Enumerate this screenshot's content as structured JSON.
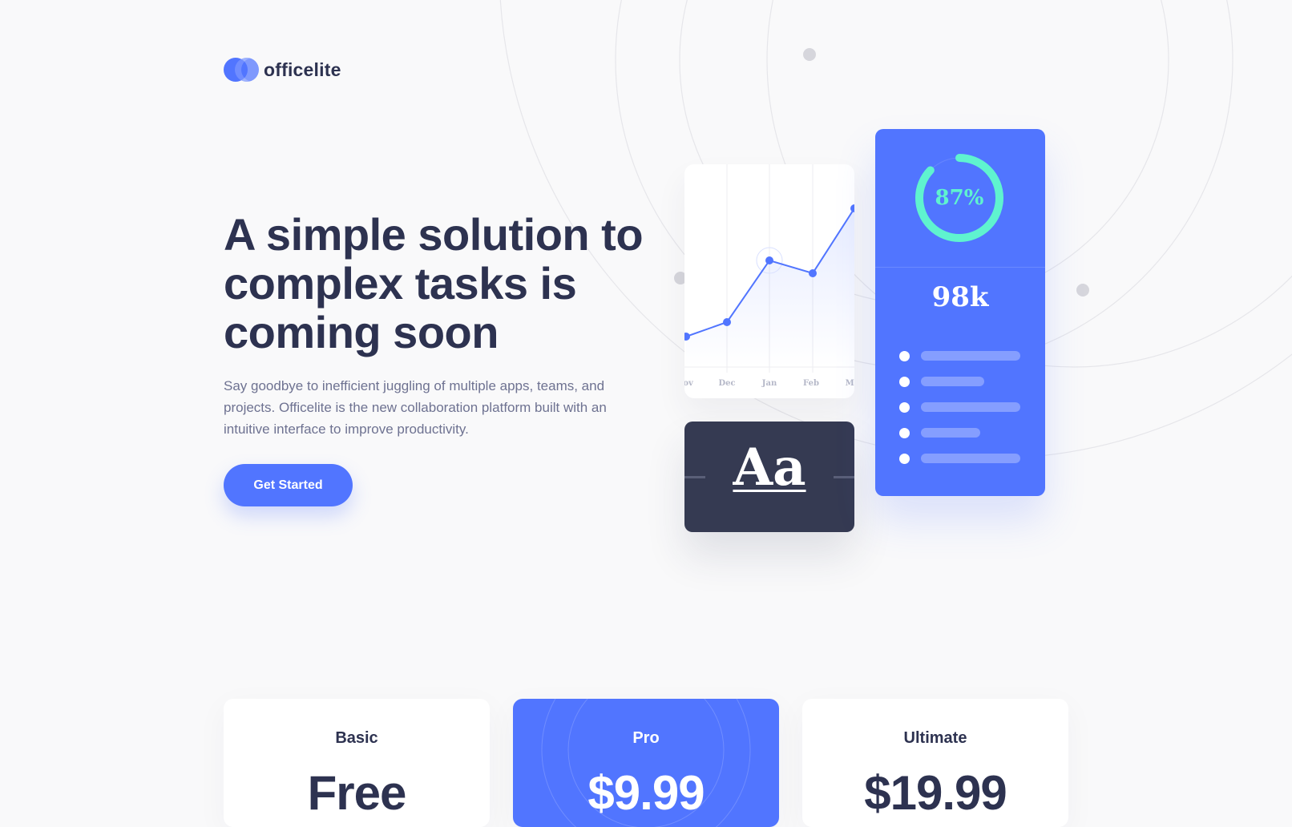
{
  "brand": {
    "name": "officelite",
    "logo_icon": "logo-icon"
  },
  "hero": {
    "title": "A simple solution to complex tasks is coming soon",
    "description": "Say goodbye to inefficient juggling of multiple apps, teams, and projects. Officelite is the new collaboration platform built with an intuitive interface to improve productivity.",
    "cta_label": "Get Started"
  },
  "illustration": {
    "chart_months": [
      "Nov",
      "Dec",
      "Jan",
      "Feb",
      "Mar"
    ],
    "typography_sample": "Aa",
    "ring_percent_label": "87%",
    "ring_progress": 0.87,
    "stat_value": "98k",
    "list_bar_fractions": [
      1.0,
      0.64,
      1.0,
      0.6,
      1.0
    ]
  },
  "pricing": {
    "plans": [
      {
        "name": "Basic",
        "price": "Free"
      },
      {
        "name": "Pro",
        "price": "$9.99"
      },
      {
        "name": "Ultimate",
        "price": "$19.99"
      }
    ]
  },
  "colors": {
    "primary": "#5175ff",
    "dark": "#2d3250",
    "card_dark": "#353a52",
    "accent_mint": "#5ff3cf",
    "text_muted": "#6e7291",
    "background": "#f9f9fa"
  }
}
